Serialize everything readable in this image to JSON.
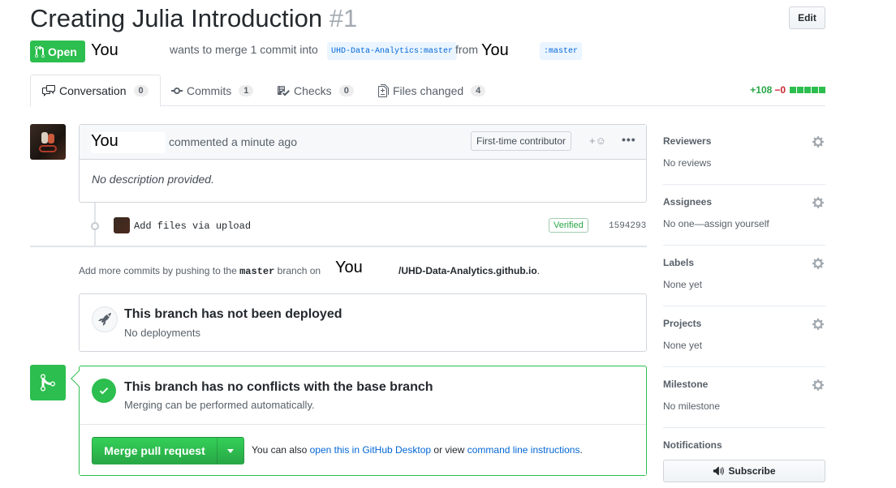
{
  "header": {
    "title": "Creating Julia Introduction",
    "number": "#1",
    "edit_label": "Edit"
  },
  "meta": {
    "state": "Open",
    "author": "You",
    "wants_text": "wants to merge 1 commit into",
    "base_branch": "UHD-Data-Analytics:master",
    "from_text": "from",
    "head_author": "You",
    "head_branch": ":master"
  },
  "tabs": [
    {
      "label": "Conversation",
      "count": "0"
    },
    {
      "label": "Commits",
      "count": "1"
    },
    {
      "label": "Checks",
      "count": "0"
    },
    {
      "label": "Files changed",
      "count": "4"
    }
  ],
  "diffstat": {
    "additions": "+108",
    "deletions": "−0"
  },
  "comment": {
    "author": "You",
    "meta": "commented a minute ago",
    "badge": "First-time contributor",
    "react": "+☺",
    "more": "•••",
    "body": "No description provided."
  },
  "commit": {
    "message": "Add files via upload",
    "verified": "Verified",
    "sha": "1594293"
  },
  "push_hint": {
    "prefix": "Add more commits by pushing to the",
    "branch": "master",
    "middle": "branch on",
    "author": "You",
    "repo": "/UHD-Data-Analytics.github.io",
    "suffix": "."
  },
  "deploy": {
    "title": "This branch has not been deployed",
    "subtitle": "No deployments"
  },
  "merge": {
    "title": "This branch has no conflicts with the base branch",
    "subtitle": "Merging can be performed automatically.",
    "button": "Merge pull request",
    "alt_prefix": "You can also",
    "alt_link1": "open this in GitHub Desktop",
    "alt_middle": "or view",
    "alt_link2": "command line instructions",
    "alt_suffix": "."
  },
  "sidebar": {
    "sections": [
      {
        "head": "Reviewers",
        "value": "No reviews"
      },
      {
        "head": "Assignees",
        "value": "No one—assign yourself"
      },
      {
        "head": "Labels",
        "value": "None yet"
      },
      {
        "head": "Projects",
        "value": "None yet"
      },
      {
        "head": "Milestone",
        "value": "No milestone"
      }
    ],
    "notifications_head": "Notifications",
    "subscribe_label": "Subscribe"
  },
  "colors": {
    "open_green": "#2cbe4e",
    "link_blue": "#0366d6",
    "deletion_red": "#cb2431"
  }
}
